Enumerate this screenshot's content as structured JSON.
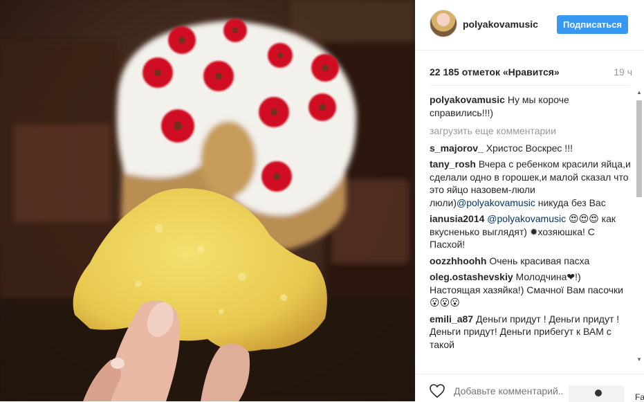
{
  "post": {
    "username": "polyakovamusic",
    "follow_label": "Подписаться",
    "likes": "22 185 отметок «Нравится»",
    "time": "19 ч"
  },
  "comments": {
    "caption_user": "polyakovamusic",
    "caption_text": "Ну мы короче справились!!!)",
    "load_more": "загрузить еще комментарии",
    "items": [
      {
        "user": "s_majorov_",
        "text": "Христос Воскрес !!!"
      },
      {
        "user": "tany_rosh",
        "text": "Вчера с ребенком красили яйца,и сделали одно в горошек,и малой сказал что это яйцо назовем-люли люли)",
        "mention": "@polyakovamusic",
        "text2": " никуда без Вас"
      },
      {
        "user": "ianusia2014",
        "mention": "@polyakovamusic",
        "text": " 😍😍😍 как вкусненько выглядят) ✹хозяюшка! С Пасхой!"
      },
      {
        "user": "oozzhhoohh",
        "text": "Очень красивая пасха"
      },
      {
        "user": "oleg.ostashevskiy",
        "text": "Молодчина❤!) Настоящая хазяйка!) Смачної Вам пасочки 😮😮😮"
      },
      {
        "user": "emili_a87",
        "text": "Деньги придут ! Деньги придут ! Деньги придут! Деньги прибегут к ВАМ с такой"
      }
    ]
  },
  "footer": {
    "add_comment_placeholder": "Добавьте комментарий...",
    "fa_text": "Fa"
  },
  "colors": {
    "accent": "#3897f0",
    "mention": "#003569",
    "muted": "#999999"
  },
  "icons": [
    "heart-icon",
    "scroll-up-icon",
    "scroll-down-icon"
  ]
}
